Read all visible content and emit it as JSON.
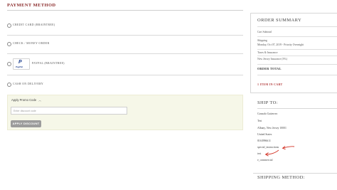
{
  "payment": {
    "title": "PAYMENT METHOD",
    "options": [
      {
        "label": "CREDIT CARD (BRAINTREE)",
        "selected": false
      },
      {
        "label": "CHECK / MONEY ORDER",
        "selected": false
      },
      {
        "label": "PAYPAL (BRAINTREE)",
        "selected": false,
        "logo": {
          "glyph": "P",
          "text": "PayPal"
        }
      },
      {
        "label": "CASH ON DELIVERY",
        "selected": false
      }
    ],
    "promo": {
      "toggle_label": "Apply Promo Code",
      "toggle_icon": "chevron-up-icon",
      "input_placeholder": "Enter discount code",
      "button_label": "APPLY DISCOUNT"
    }
  },
  "order_summary": {
    "title": "ORDER SUMMARY",
    "cart_subtotal": "Cart Subtotal",
    "shipping_label": "Shipping",
    "shipping_detail": "Monday, Oct 07, 2019 - Priority Overnight",
    "taxes_label": "Taxes & Insurance",
    "taxes_detail": "New Jersey Insurance (3%)",
    "total_label": "ORDER TOTAL",
    "cart_count": "1 ITEM IN CART"
  },
  "ship_to": {
    "title": "SHIP TO:",
    "lines": [
      "Gonzalo Gutierrez",
      "Test",
      "Albany, New Jersey 10001",
      "United States",
      "8163996611",
      "special_instructions",
      "test",
      "e_commercial"
    ],
    "annotation_color": "#d4372a"
  },
  "shipping_method": {
    "title": "SHIPPING METHOD:"
  },
  "colors": {
    "accent": "#8a2a2a",
    "cart_link": "#b23a3a",
    "promo_bg": "#f6f7e8",
    "button_gray": "#9c9c9c"
  }
}
